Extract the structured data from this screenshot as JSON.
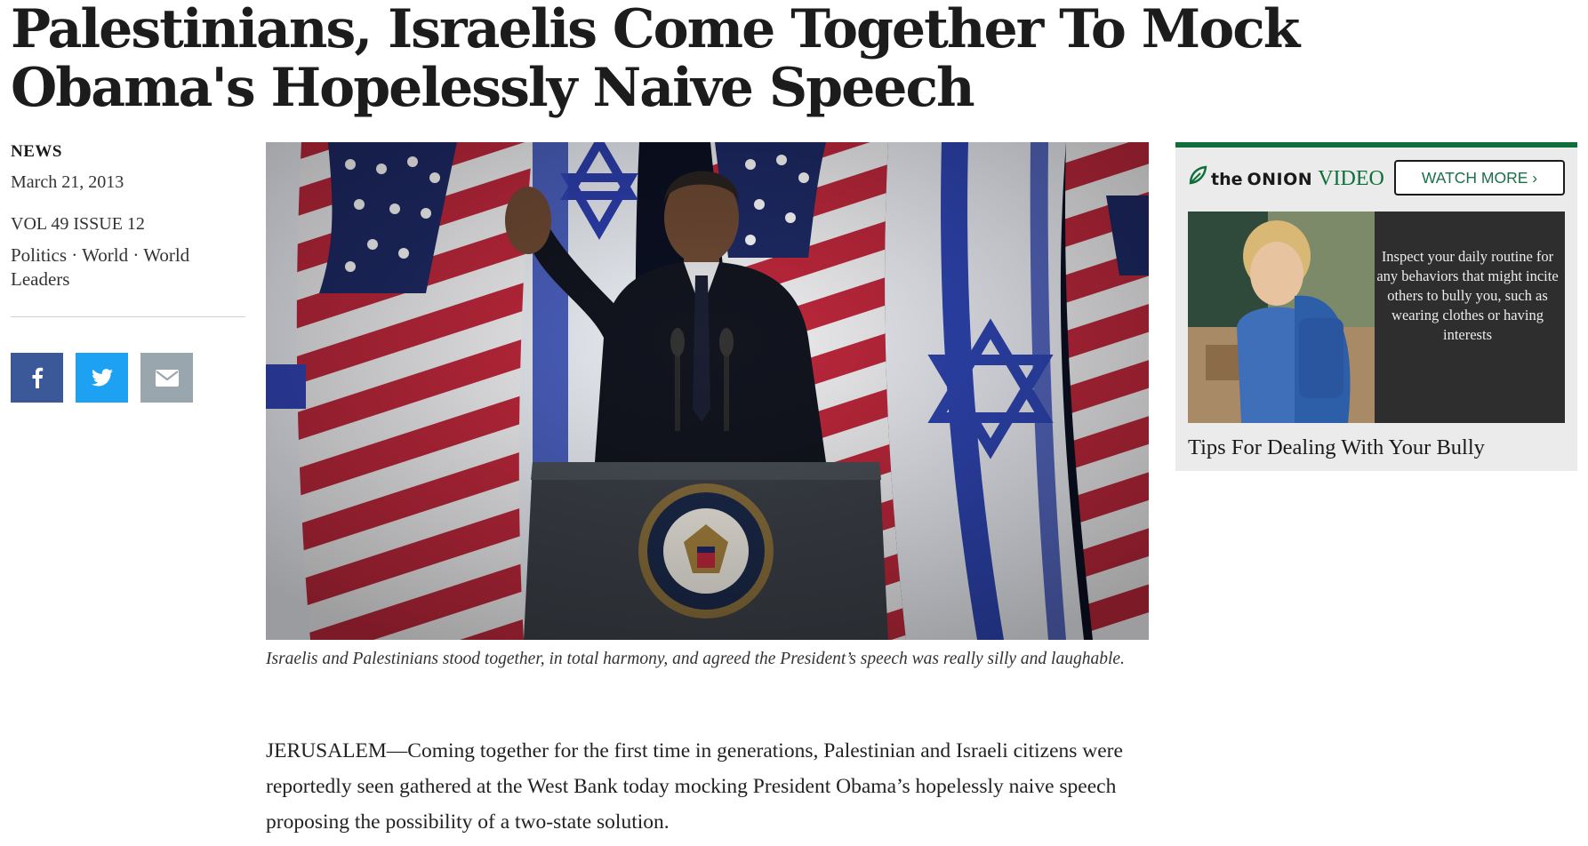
{
  "article": {
    "headline": "Palestinians, Israelis Come Together To Mock Obama's Hopelessly Naive Speech",
    "section": "NEWS",
    "date": "March 21, 2013",
    "volume": "VOL 49 ISSUE 12",
    "tags": "Politics · World · World Leaders",
    "caption": "Israelis and Palestinians stood together, in total harmony, and agreed the President’s speech was really silly and laughable.",
    "body": "JERUSALEM—Coming together for the first time in generations, Palestinian and Israeli citizens were reportedly seen gathered at the West Bank today mocking President Obama’s hopelessly naive speech proposing the possibility of a two-state solution."
  },
  "share": {
    "facebook_icon": "facebook-icon",
    "twitter_icon": "twitter-icon",
    "email_icon": "email-icon"
  },
  "video_widget": {
    "logo_the": "the",
    "logo_onion": "ONION",
    "logo_video": "VIDEO",
    "watch_more": "WATCH MORE ›",
    "thumb_text": "Inspect your daily routine for any behaviors that might incite others to bully you, such as wearing clothes or having interests",
    "title": "Tips For Dealing With Your Bully"
  },
  "colors": {
    "onion_green": "#0e6f3a",
    "facebook": "#3b5998",
    "twitter": "#1da1f2",
    "email": "#9aa6ae"
  }
}
